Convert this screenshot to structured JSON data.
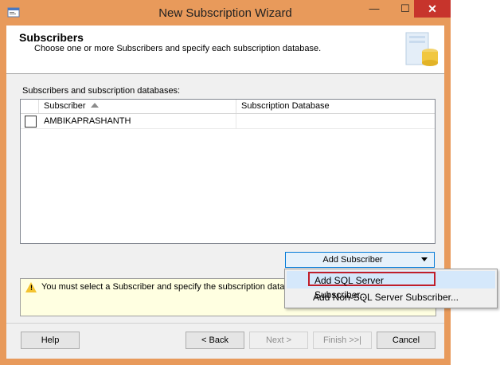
{
  "window": {
    "title": "New Subscription Wizard",
    "minimize_glyph": "—",
    "maximize_glyph": "☐",
    "close_glyph": "✕"
  },
  "header": {
    "title": "Subscribers",
    "subtitle": "Choose one or more Subscribers and specify each subscription database."
  },
  "grid": {
    "label": "Subscribers and subscription databases:",
    "columns": [
      "Subscriber",
      "Subscription Database"
    ],
    "rows": [
      {
        "checked": false,
        "subscriber": "AMBIKAPRASHANTH",
        "database": ""
      }
    ]
  },
  "add_subscriber": {
    "label": "Add Subscriber",
    "menu": [
      "Add SQL Server Subscriber...",
      "Add Non-SQL Server Subscriber..."
    ]
  },
  "message": "You must select a Subscriber and specify the subscription databa",
  "footer": {
    "help": "Help",
    "back": "< Back",
    "next": "Next >",
    "finish": "Finish >>|",
    "cancel": "Cancel"
  },
  "colors": {
    "frame": "#e89a5b",
    "close": "#c7342c",
    "highlight_border": "#c01e2a",
    "message_bg": "#ffffe1"
  }
}
